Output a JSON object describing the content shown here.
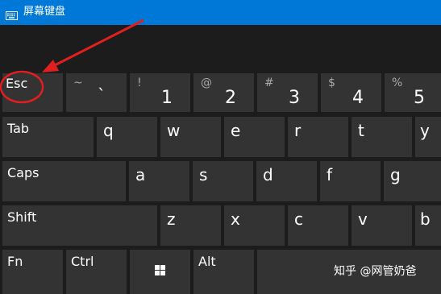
{
  "window": {
    "title": "屏幕键盘",
    "icon": "keyboard-icon",
    "accent_color": "#0078d7"
  },
  "keyboard": {
    "key_color": "#333333",
    "row1": [
      {
        "label": "Esc"
      },
      {
        "top": "~",
        "main": "`"
      },
      {
        "top": "!",
        "main": "1"
      },
      {
        "top": "@",
        "main": "2"
      },
      {
        "top": "#",
        "main": "3"
      },
      {
        "top": "$",
        "main": "4"
      },
      {
        "top": "%",
        "main": "5"
      }
    ],
    "row2": [
      "Tab",
      "q",
      "w",
      "e",
      "r",
      "t",
      "y"
    ],
    "row3": [
      "Caps",
      "a",
      "s",
      "d",
      "f",
      "g"
    ],
    "row4": [
      "Shift",
      "z",
      "x",
      "c",
      "v",
      "b"
    ],
    "row5": {
      "fn": "Fn",
      "ctrl": "Ctrl",
      "windows_icon": "windows-logo-icon",
      "alt": "Alt"
    }
  },
  "annotation": {
    "color": "#e02020",
    "shapes": [
      "red-circle-around-esc",
      "red-arrow-pointing-to-esc"
    ]
  },
  "watermark": "知乎 @网管奶爸"
}
